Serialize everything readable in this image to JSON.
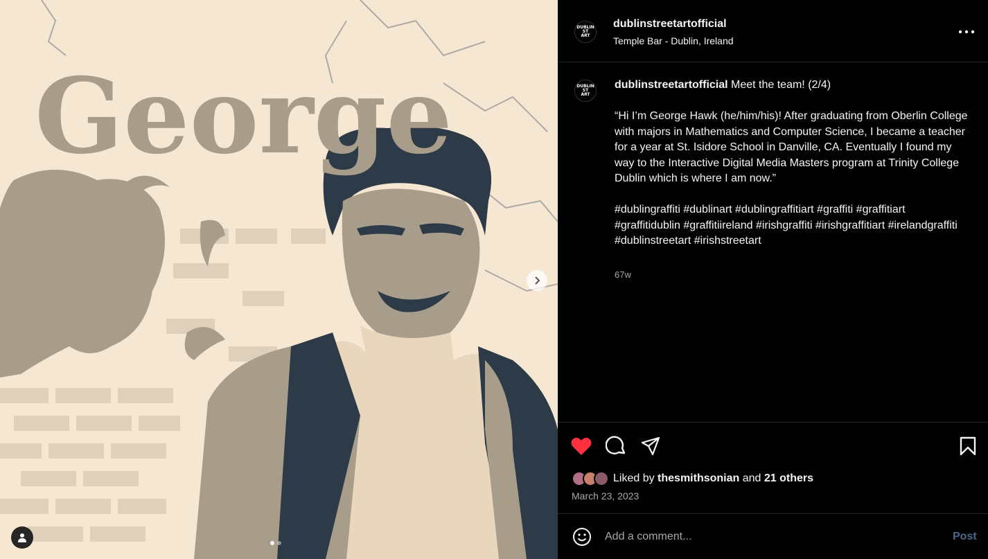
{
  "media": {
    "art_title": "George",
    "palette": {
      "cream": "#f6e7d2",
      "taupe": "#a89c8a",
      "navy": "#2d3a48"
    },
    "next_icon": "chevron-right-icon",
    "tag_icon": "user-tag-icon",
    "carousel": {
      "count": 2,
      "active": 0
    }
  },
  "header": {
    "avatar_text": [
      "DUBLIN",
      "ST",
      "ART"
    ],
    "username": "dublinstreetartofficial",
    "location": "Temple Bar - Dublin, Ireland",
    "more_icon": "more-horizontal-icon"
  },
  "caption": {
    "username": "dublinstreetartofficial",
    "headline": "Meet the team! (2/4)",
    "body": "“Hi I’m George Hawk (he/him/his)! After graduating from Oberlin College with majors in Mathematics and Computer Science, I became a teacher for a year at St. Isidore School in Danville, CA. Eventually I found my way to the Interactive Digital Media Masters program at Trinity College Dublin which is where I am now.”",
    "hashtags": "#dublingraffiti #dublinart #dublingraffitiart #graffiti #graffitiart #graffitidublin #graffitiireland #irishgraffiti #irishgraffitiart #irelandgraffiti #dublinstreetart #irishstreetart",
    "time": "67w"
  },
  "actions": {
    "like_icon": "heart-filled-icon",
    "comment_icon": "comment-icon",
    "share_icon": "share-icon",
    "save_icon": "bookmark-icon",
    "liked_prefix": "Liked by",
    "liked_user": "thesmithsonian",
    "liked_and": "and",
    "liked_others": "21 others",
    "date": "March 23, 2023",
    "colors": {
      "like": "#ff3040",
      "post_disabled": "#4b6a8a"
    }
  },
  "comment": {
    "emoji_icon": "emoji-icon",
    "placeholder": "Add a comment...",
    "post_label": "Post"
  }
}
